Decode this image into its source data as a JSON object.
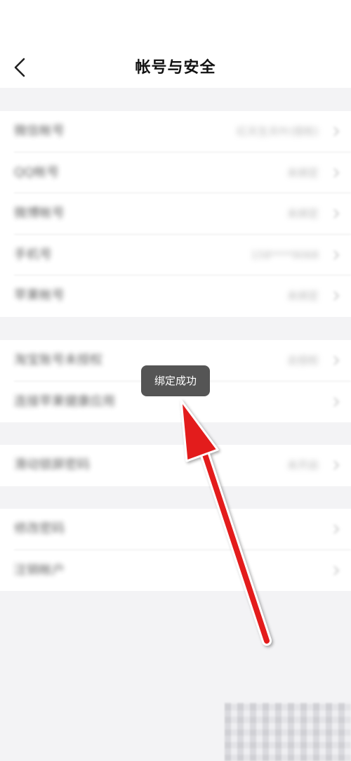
{
  "header": {
    "title": "帐号与安全",
    "back_icon": "chevron-left-icon"
  },
  "sections": [
    {
      "rows": [
        {
          "label": "微信帐号",
          "value": "红天生天叶(授权)"
        },
        {
          "label": "QQ帐号",
          "value": "未绑定"
        },
        {
          "label": "微博帐号",
          "value": "未绑定"
        },
        {
          "label": "手机号",
          "value": "158****9068"
        },
        {
          "label": "苹果帐号",
          "value": "未绑定"
        }
      ]
    },
    {
      "rows": [
        {
          "label": "淘宝账号未授权",
          "value": "去授权"
        },
        {
          "label": "连接苹果健康应用",
          "value": ""
        }
      ]
    },
    {
      "rows": [
        {
          "label": "滑动锁屏密码",
          "value": "未开启"
        }
      ]
    },
    {
      "rows": [
        {
          "label": "修改密码",
          "value": ""
        },
        {
          "label": "注销帐户",
          "value": ""
        }
      ]
    }
  ],
  "toast": {
    "text": "绑定成功"
  },
  "annotation": {
    "arrow_color": "#e31d1d",
    "arrow_icon": "red-arrow-annotation"
  }
}
